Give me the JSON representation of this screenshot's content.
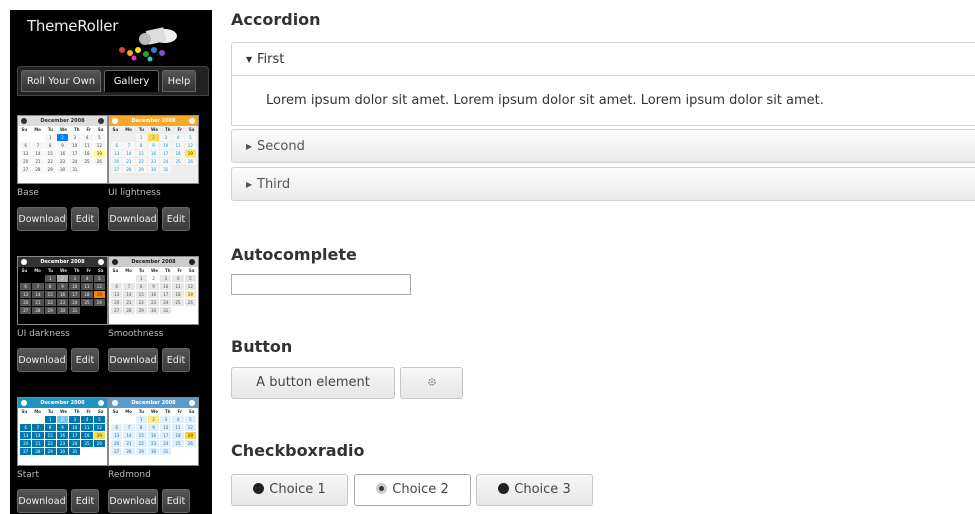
{
  "sidebar": {
    "logo_text": "ThemeRoller",
    "tabs": [
      {
        "label": "Roll Your Own"
      },
      {
        "label": "Gallery"
      },
      {
        "label": "Help"
      }
    ],
    "download_label": "Download",
    "edit_label": "Edit",
    "calendar_title": "December 2008",
    "weekdays": [
      "Su",
      "Mo",
      "Tu",
      "We",
      "Th",
      "Fr",
      "Sa"
    ],
    "themes": [
      {
        "name": "Base",
        "header": "#ddd",
        "header_text": "#333",
        "cell": "#f6f6f6",
        "cell_text": "#454545",
        "selected": "#007fff",
        "highlight": "#fffa90",
        "body": "#fff"
      },
      {
        "name": "UI lightness",
        "header": "#f6a828",
        "header_text": "#fff",
        "cell": "#f6f6f6",
        "cell_text": "#1c94c4",
        "selected": "#fbd850",
        "highlight": "#ffe45c",
        "body": "#eee"
      },
      {
        "name": "UI darkness",
        "header": "#333",
        "header_text": "#fff",
        "cell": "#555",
        "cell_text": "#eee",
        "selected": "#aaa",
        "highlight": "#f58400",
        "body": "#000"
      },
      {
        "name": "Smoothness",
        "header": "#ccc",
        "header_text": "#222",
        "cell": "#e6e6e6",
        "cell_text": "#555",
        "selected": "#fdfdfd",
        "highlight": "#fcefa1",
        "body": "#fff"
      },
      {
        "name": "Start",
        "header": "#2191c0",
        "header_text": "#fff",
        "cell": "#0078ae",
        "cell_text": "#fff",
        "selected": "#79c9ec",
        "highlight": "#f8da4e",
        "body": "#fff"
      },
      {
        "name": "Redmond",
        "header": "#5c9ccc",
        "header_text": "#fff",
        "cell": "#dfeffc",
        "cell_text": "#2e6e9e",
        "selected": "#fbec88",
        "highlight": "#fad42e",
        "body": "#fff"
      }
    ]
  },
  "main": {
    "accordion": {
      "title": "Accordion",
      "sections": [
        "First",
        "Second",
        "Third"
      ],
      "content": "Lorem ipsum dolor sit amet. Lorem ipsum dolor sit amet. Lorem ipsum dolor sit amet."
    },
    "autocomplete": {
      "title": "Autocomplete",
      "value": ""
    },
    "button": {
      "title": "Button",
      "label": "A button element",
      "icon": "gear-icon"
    },
    "checkboxradio": {
      "title": "Checkboxradio",
      "choices": [
        {
          "label": "Choice 1",
          "checked": false
        },
        {
          "label": "Choice 2",
          "checked": true
        },
        {
          "label": "Choice 3",
          "checked": false
        }
      ]
    }
  }
}
